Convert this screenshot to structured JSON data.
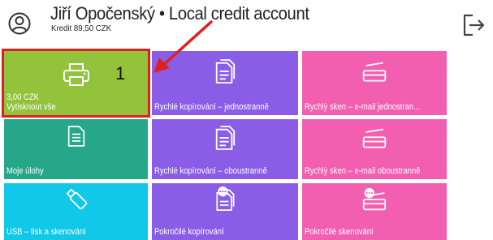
{
  "header": {
    "user_name": "Jiří Opočenský • Local credit account",
    "credit": "Kredit 89,50 CZK"
  },
  "colors": {
    "green": "#93c33a",
    "purple": "#8a5de7",
    "pink": "#f25fb1",
    "teal": "#27a78a",
    "cyan": "#12c8e8",
    "highlight": "#e02020"
  },
  "tiles": {
    "print_all": {
      "icon": "printer-icon",
      "price": "3,00 CZK",
      "label": "Vytisknout vše",
      "count": "1"
    },
    "quick_copy_simplex": {
      "icon": "copy-document-icon",
      "label": "Rychlé kopírování – jednostranně"
    },
    "quick_scan_email_simplex": {
      "icon": "scanner-icon",
      "label": "Rychlý sken – e-mail jednostran..."
    },
    "my_jobs": {
      "icon": "document-icon",
      "label": "Moje úlohy"
    },
    "quick_copy_duplex": {
      "icon": "copy-document-icon",
      "label": "Rychlé kopírování – oboustranně"
    },
    "quick_scan_email_duplex": {
      "icon": "scanner-icon",
      "label": "Rychlý sken – e-mail oboustranně"
    },
    "usb_print_scan": {
      "icon": "usb-drive-icon",
      "label": "USB – tisk a skenování"
    },
    "advanced_copy": {
      "icon": "advanced-copy-icon",
      "label": "Pokročilé kopírování"
    },
    "advanced_scan": {
      "icon": "advanced-scan-icon",
      "label": "Pokročilé skenování"
    }
  }
}
